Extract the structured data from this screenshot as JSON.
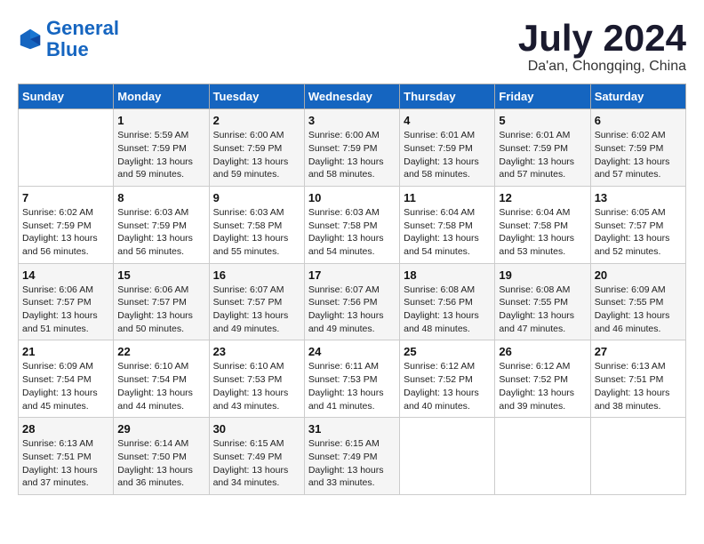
{
  "header": {
    "logo_line1": "General",
    "logo_line2": "Blue",
    "month_title": "July 2024",
    "location": "Da'an, Chongqing, China"
  },
  "weekdays": [
    "Sunday",
    "Monday",
    "Tuesday",
    "Wednesday",
    "Thursday",
    "Friday",
    "Saturday"
  ],
  "weeks": [
    [
      {
        "day": "",
        "info": ""
      },
      {
        "day": "1",
        "info": "Sunrise: 5:59 AM\nSunset: 7:59 PM\nDaylight: 13 hours\nand 59 minutes."
      },
      {
        "day": "2",
        "info": "Sunrise: 6:00 AM\nSunset: 7:59 PM\nDaylight: 13 hours\nand 59 minutes."
      },
      {
        "day": "3",
        "info": "Sunrise: 6:00 AM\nSunset: 7:59 PM\nDaylight: 13 hours\nand 58 minutes."
      },
      {
        "day": "4",
        "info": "Sunrise: 6:01 AM\nSunset: 7:59 PM\nDaylight: 13 hours\nand 58 minutes."
      },
      {
        "day": "5",
        "info": "Sunrise: 6:01 AM\nSunset: 7:59 PM\nDaylight: 13 hours\nand 57 minutes."
      },
      {
        "day": "6",
        "info": "Sunrise: 6:02 AM\nSunset: 7:59 PM\nDaylight: 13 hours\nand 57 minutes."
      }
    ],
    [
      {
        "day": "7",
        "info": "Sunrise: 6:02 AM\nSunset: 7:59 PM\nDaylight: 13 hours\nand 56 minutes."
      },
      {
        "day": "8",
        "info": "Sunrise: 6:03 AM\nSunset: 7:59 PM\nDaylight: 13 hours\nand 56 minutes."
      },
      {
        "day": "9",
        "info": "Sunrise: 6:03 AM\nSunset: 7:58 PM\nDaylight: 13 hours\nand 55 minutes."
      },
      {
        "day": "10",
        "info": "Sunrise: 6:03 AM\nSunset: 7:58 PM\nDaylight: 13 hours\nand 54 minutes."
      },
      {
        "day": "11",
        "info": "Sunrise: 6:04 AM\nSunset: 7:58 PM\nDaylight: 13 hours\nand 54 minutes."
      },
      {
        "day": "12",
        "info": "Sunrise: 6:04 AM\nSunset: 7:58 PM\nDaylight: 13 hours\nand 53 minutes."
      },
      {
        "day": "13",
        "info": "Sunrise: 6:05 AM\nSunset: 7:57 PM\nDaylight: 13 hours\nand 52 minutes."
      }
    ],
    [
      {
        "day": "14",
        "info": "Sunrise: 6:06 AM\nSunset: 7:57 PM\nDaylight: 13 hours\nand 51 minutes."
      },
      {
        "day": "15",
        "info": "Sunrise: 6:06 AM\nSunset: 7:57 PM\nDaylight: 13 hours\nand 50 minutes."
      },
      {
        "day": "16",
        "info": "Sunrise: 6:07 AM\nSunset: 7:57 PM\nDaylight: 13 hours\nand 49 minutes."
      },
      {
        "day": "17",
        "info": "Sunrise: 6:07 AM\nSunset: 7:56 PM\nDaylight: 13 hours\nand 49 minutes."
      },
      {
        "day": "18",
        "info": "Sunrise: 6:08 AM\nSunset: 7:56 PM\nDaylight: 13 hours\nand 48 minutes."
      },
      {
        "day": "19",
        "info": "Sunrise: 6:08 AM\nSunset: 7:55 PM\nDaylight: 13 hours\nand 47 minutes."
      },
      {
        "day": "20",
        "info": "Sunrise: 6:09 AM\nSunset: 7:55 PM\nDaylight: 13 hours\nand 46 minutes."
      }
    ],
    [
      {
        "day": "21",
        "info": "Sunrise: 6:09 AM\nSunset: 7:54 PM\nDaylight: 13 hours\nand 45 minutes."
      },
      {
        "day": "22",
        "info": "Sunrise: 6:10 AM\nSunset: 7:54 PM\nDaylight: 13 hours\nand 44 minutes."
      },
      {
        "day": "23",
        "info": "Sunrise: 6:10 AM\nSunset: 7:53 PM\nDaylight: 13 hours\nand 43 minutes."
      },
      {
        "day": "24",
        "info": "Sunrise: 6:11 AM\nSunset: 7:53 PM\nDaylight: 13 hours\nand 41 minutes."
      },
      {
        "day": "25",
        "info": "Sunrise: 6:12 AM\nSunset: 7:52 PM\nDaylight: 13 hours\nand 40 minutes."
      },
      {
        "day": "26",
        "info": "Sunrise: 6:12 AM\nSunset: 7:52 PM\nDaylight: 13 hours\nand 39 minutes."
      },
      {
        "day": "27",
        "info": "Sunrise: 6:13 AM\nSunset: 7:51 PM\nDaylight: 13 hours\nand 38 minutes."
      }
    ],
    [
      {
        "day": "28",
        "info": "Sunrise: 6:13 AM\nSunset: 7:51 PM\nDaylight: 13 hours\nand 37 minutes."
      },
      {
        "day": "29",
        "info": "Sunrise: 6:14 AM\nSunset: 7:50 PM\nDaylight: 13 hours\nand 36 minutes."
      },
      {
        "day": "30",
        "info": "Sunrise: 6:15 AM\nSunset: 7:49 PM\nDaylight: 13 hours\nand 34 minutes."
      },
      {
        "day": "31",
        "info": "Sunrise: 6:15 AM\nSunset: 7:49 PM\nDaylight: 13 hours\nand 33 minutes."
      },
      {
        "day": "",
        "info": ""
      },
      {
        "day": "",
        "info": ""
      },
      {
        "day": "",
        "info": ""
      }
    ]
  ]
}
